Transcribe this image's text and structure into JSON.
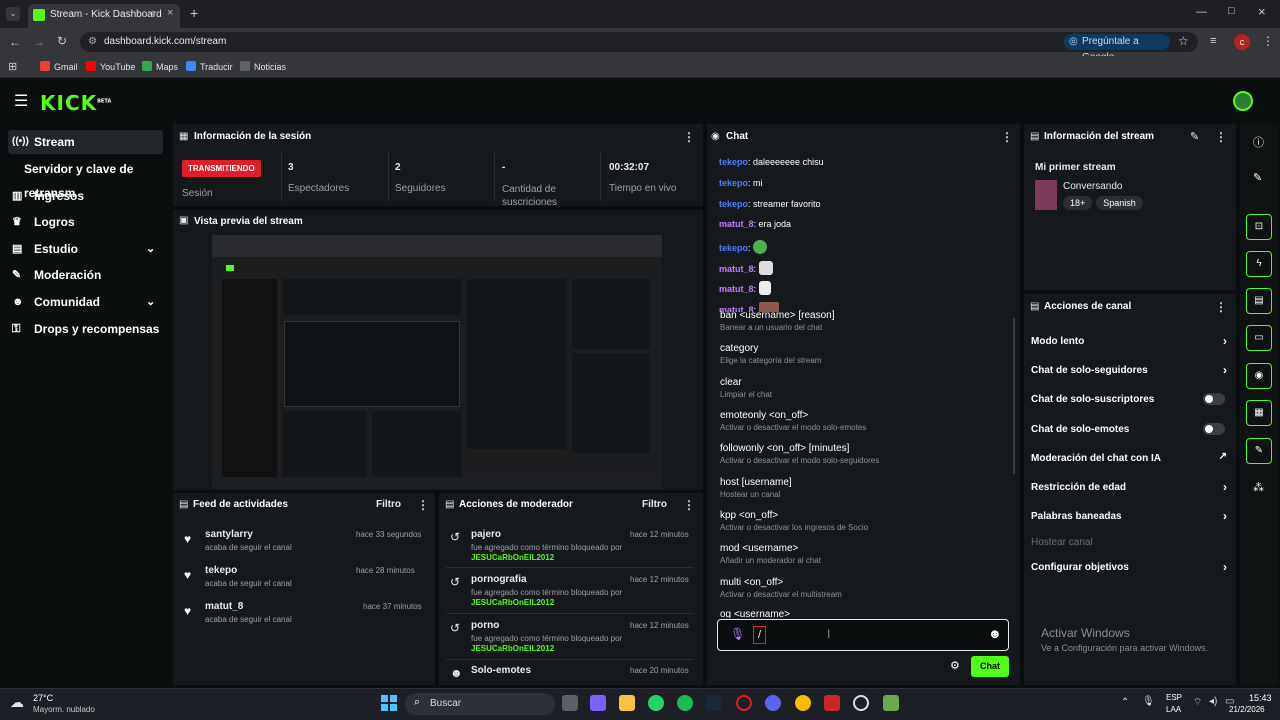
{
  "browser": {
    "tab_title": "Stream - Kick Dashboard",
    "url": "dashboard.kick.com/stream",
    "google_btn": "Pregúntale a Google",
    "profile_initial": "c",
    "bookmarks": [
      "Gmail",
      "YouTube",
      "Maps",
      "Traducir",
      "Noticias"
    ]
  },
  "app": {
    "logo": "KICK",
    "logo_sup": "BETA"
  },
  "sidebar": {
    "items": [
      {
        "label": "Stream"
      },
      {
        "label": "Servidor y clave de retransm"
      },
      {
        "label": "Ingresos"
      },
      {
        "label": "Logros"
      },
      {
        "label": "Estudio"
      },
      {
        "label": "Moderación"
      },
      {
        "label": "Comunidad"
      },
      {
        "label": "Drops y recompensas"
      }
    ]
  },
  "session": {
    "title": "Información de la sesión",
    "status_badge": "TRANSMITIENDO",
    "status_label": "Sesión",
    "stats": [
      {
        "value": "3",
        "label": "Espectadores"
      },
      {
        "value": "2",
        "label": "Seguidores"
      },
      {
        "value": "-",
        "label": "Cantidad de suscriciones"
      },
      {
        "value": "00:32:07",
        "label": "Tiempo en vivo"
      }
    ]
  },
  "preview": {
    "title": "Vista previa del stream"
  },
  "feed": {
    "title": "Feed de actividades",
    "filter": "Filtro",
    "rows": [
      {
        "user": "santylarry",
        "time": "hace 33 segundos",
        "desc": "acaba de seguir el canal"
      },
      {
        "user": "tekepo",
        "time": "hace 28 minutos",
        "desc": "acaba de seguir el canal"
      },
      {
        "user": "matut_8",
        "time": "hace 37 minutos",
        "desc": "acaba de seguir el canal"
      }
    ]
  },
  "modactions": {
    "title": "Acciones de moderador",
    "filter": "Filtro",
    "rows": [
      {
        "term": "pajero",
        "time": "hace 12 minutos",
        "desc": "fue agregado como término bloqueado por",
        "by": "JESUCaRbOnEIL2012"
      },
      {
        "term": "pornografia",
        "time": "hace 12 minutos",
        "desc": "fue agregado como término bloqueado por",
        "by": "JESUCaRbOnEIL2012"
      },
      {
        "term": "porno",
        "time": "hace 12 minutos",
        "desc": "fue agregado como término bloqueado por",
        "by": "JESUCaRbOnEIL2012"
      },
      {
        "term": "Solo-emotes",
        "time": "hace 20 minutos",
        "desc": "",
        "by": ""
      }
    ]
  },
  "chat": {
    "title": "Chat",
    "messages": [
      {
        "user": "tekepo",
        "text": ": daleeeeeee chisu",
        "color": "#4f7bff"
      },
      {
        "user": "tekepo",
        "text": ": mi",
        "color": "#4f7bff"
      },
      {
        "user": "tekepo",
        "text": ": streamer favorito",
        "color": "#4f7bff"
      },
      {
        "user": "matut_8",
        "text": ": era joda",
        "color": "#c37cff"
      },
      {
        "user": "tekepo",
        "text": ":",
        "color": "#4f7bff"
      },
      {
        "user": "matut_8",
        "text": ":",
        "color": "#c37cff"
      },
      {
        "user": "matut_8",
        "text": ":",
        "color": "#c37cff"
      },
      {
        "user": "matut_8",
        "text": ":",
        "color": "#c37cff"
      }
    ],
    "commands": [
      {
        "name": "ban <username> [reason]",
        "desc": "Banear a un usuario del chat"
      },
      {
        "name": "category",
        "desc": "Elige la categoría del stream"
      },
      {
        "name": "clear",
        "desc": "Limpiar el chat"
      },
      {
        "name": "emoteonly <on_off>",
        "desc": "Activar o desactivar el modo solo-emotes"
      },
      {
        "name": "followonly <on_off> [minutes]",
        "desc": "Activar o desactivar el modo solo-seguidores"
      },
      {
        "name": "host [username]",
        "desc": "Hostear un canal"
      },
      {
        "name": "kpp <on_off>",
        "desc": "Activar o desactivar los ingresos de Socio"
      },
      {
        "name": "mod <username>",
        "desc": "Añadir un moderador al chat"
      },
      {
        "name": "multi <on_off>",
        "desc": "Activar o desactivar el multistream"
      },
      {
        "name": "og <username>",
        "desc": ""
      }
    ],
    "input_value": "/",
    "send_label": "Chat"
  },
  "streaminfo": {
    "title": "Información del stream",
    "stream_title": "Mi primer stream",
    "category": "Conversando",
    "tags": [
      "18+",
      "Spanish"
    ]
  },
  "channelactions": {
    "title": "Acciones de canal",
    "items": [
      {
        "label": "Modo lento",
        "kind": "arrow"
      },
      {
        "label": "Chat de solo-seguidores",
        "kind": "arrow"
      },
      {
        "label": "Chat de solo-suscriptores",
        "kind": "toggle"
      },
      {
        "label": "Chat de solo-emotes",
        "kind": "toggle"
      },
      {
        "label": "Moderación del chat con IA",
        "kind": "external"
      },
      {
        "label": "Restricción de edad",
        "kind": "arrow"
      },
      {
        "label": "Palabras baneadas",
        "kind": "arrow"
      },
      {
        "label": "Hostear canal",
        "kind": "disabled"
      },
      {
        "label": "Configurar objetivos",
        "kind": "arrow"
      }
    ]
  },
  "watermark": {
    "line1": "Activar Windows",
    "line2": "Ve a Configuración para activar Windows."
  },
  "taskbar": {
    "weather_temp": "27°C",
    "weather_desc": "Mayorm. nublado",
    "search": "Buscar",
    "lang1": "ESP",
    "lang2": "LAA",
    "time": "15:43",
    "date": "21/2/2026"
  },
  "colors": {
    "accent": "#53fc18",
    "live": "#e11d2a"
  }
}
